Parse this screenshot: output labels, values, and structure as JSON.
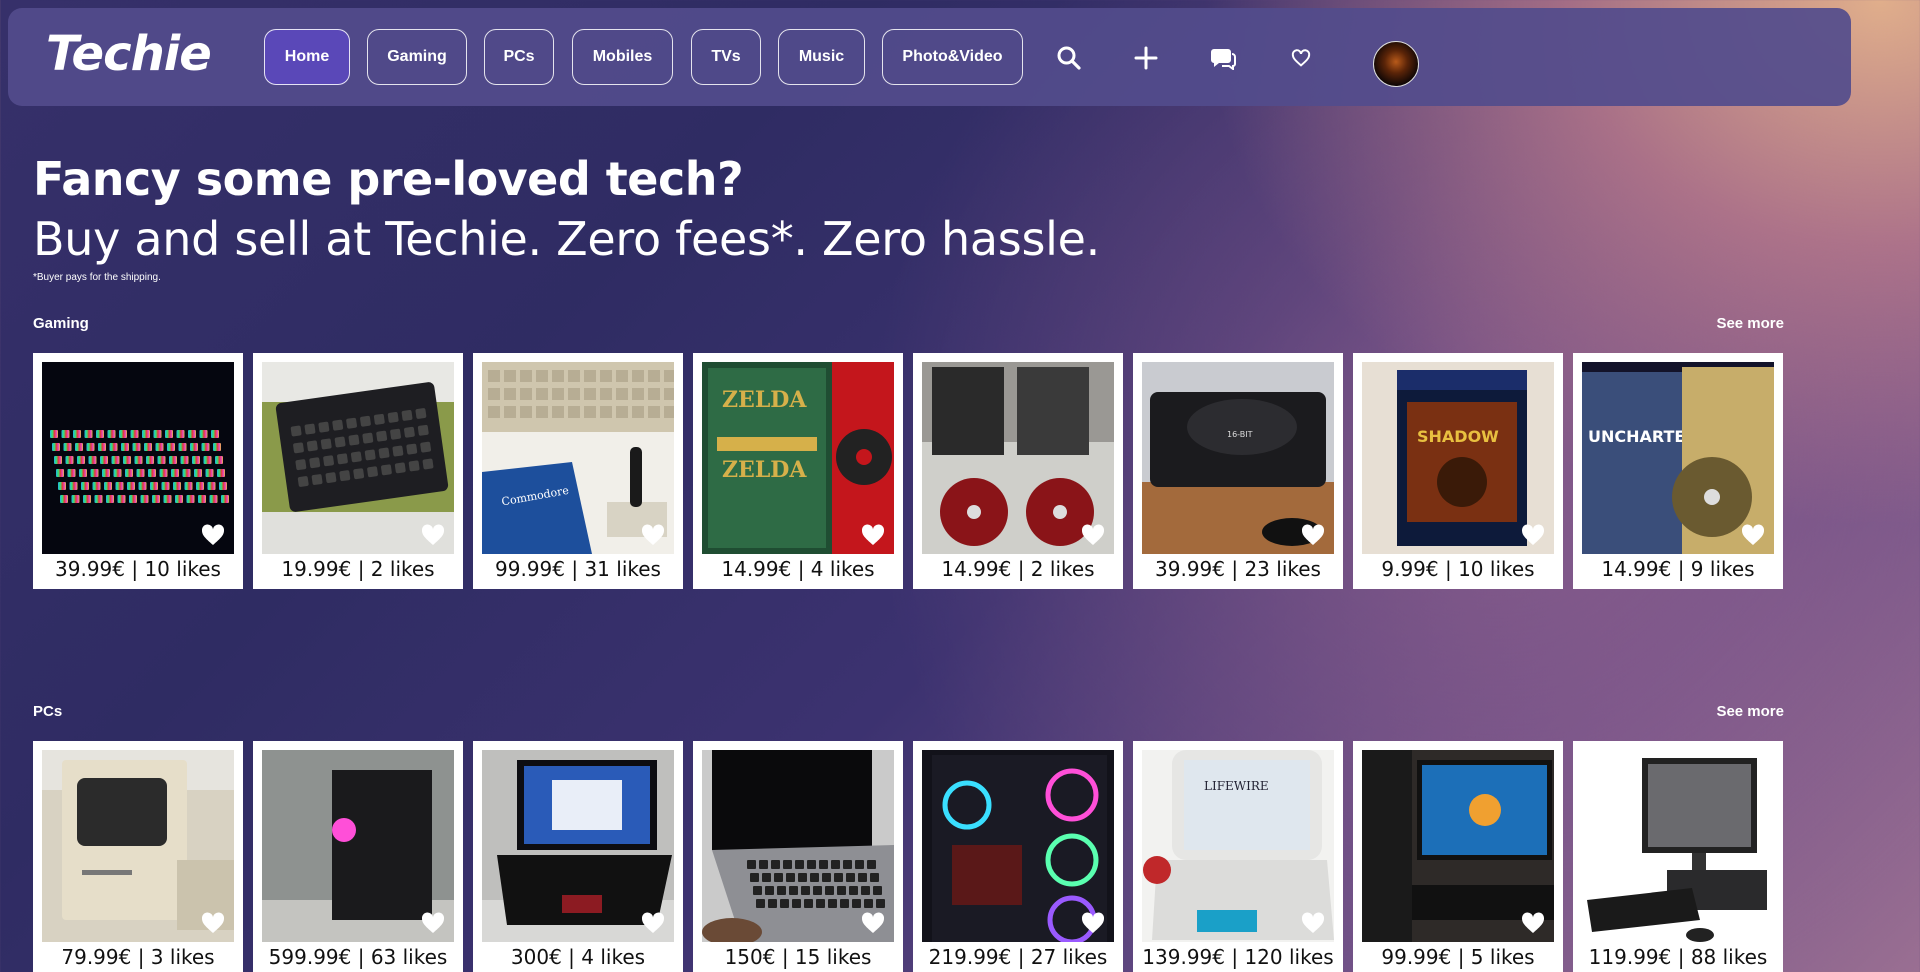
{
  "brand": {
    "logo_text": "Techie"
  },
  "nav": {
    "tabs": [
      {
        "label": "Home",
        "active": true
      },
      {
        "label": "Gaming"
      },
      {
        "label": "PCs"
      },
      {
        "label": "Mobiles"
      },
      {
        "label": "TVs"
      },
      {
        "label": "Music"
      },
      {
        "label": "Photo&Video"
      }
    ],
    "icons": [
      "search-icon",
      "plus-icon",
      "chat-icon",
      "heart-icon",
      "avatar"
    ]
  },
  "hero": {
    "headline": "Fancy some pre-loved tech?",
    "subheadline": "Buy and sell at Techie. Zero fees*. Zero hassle.",
    "footnote": "*Buyer pays for the shipping."
  },
  "sections": [
    {
      "title": "Gaming",
      "see_more": "See more",
      "items": [
        {
          "caption": "39.99€ | 10 likes",
          "image": "rgb-keyboard"
        },
        {
          "caption": "19.99€ | 2 likes",
          "image": "zx-spectrum"
        },
        {
          "caption": "99.99€ | 31 likes",
          "image": "commodore-64"
        },
        {
          "caption": "14.99€ | 4 likes",
          "image": "zelda-gamecube"
        },
        {
          "caption": "14.99€ | 2 likes",
          "image": "resident-evil-ps1"
        },
        {
          "caption": "39.99€ | 23 likes",
          "image": "sega-mega-drive"
        },
        {
          "caption": "9.99€ | 10 likes",
          "image": "shadow-ps2"
        },
        {
          "caption": "14.99€ | 9 likes",
          "image": "uncharted-3"
        }
      ]
    },
    {
      "title": "PCs",
      "see_more": "See more",
      "items": [
        {
          "caption": "79.99€ | 3 likes",
          "image": "classic-mac"
        },
        {
          "caption": "599.99€ | 63 likes",
          "image": "rgb-tower"
        },
        {
          "caption": "300€ | 4 likes",
          "image": "gaming-laptop"
        },
        {
          "caption": "150€ | 15 likes",
          "image": "macbook"
        },
        {
          "caption": "219.99€ | 27 likes",
          "image": "fan-tower"
        },
        {
          "caption": "139.99€ | 120 likes",
          "image": "ibook",
          "screen_text": "LIFEWIRE"
        },
        {
          "caption": "99.99€ | 5 likes",
          "image": "windows7-desktop"
        },
        {
          "caption": "119.99€ | 88 likes",
          "image": "lenovo-desktop"
        }
      ]
    }
  ],
  "colors": {
    "navbar": "#524c8c",
    "active_tab": "#5a48b8",
    "card": "#ffffff"
  }
}
